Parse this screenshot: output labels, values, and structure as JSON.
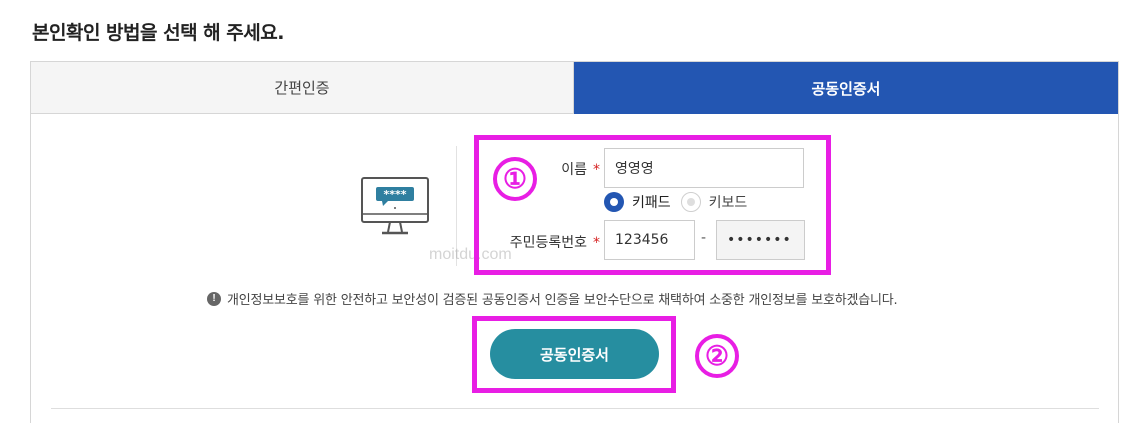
{
  "page": {
    "title": "본인확인 방법을 선택 해 주세요."
  },
  "tabs": [
    {
      "label": "간편인증",
      "active": false
    },
    {
      "label": "공동인증서",
      "active": true
    }
  ],
  "form": {
    "name_label": "이름",
    "name_value": "영영영",
    "required_mark": "*",
    "keyboard_options": [
      {
        "label": "키패드",
        "selected": true
      },
      {
        "label": "키보드",
        "selected": false
      }
    ],
    "id_label": "주민등록번호",
    "id_front_value": "123456",
    "id_separator": "-",
    "id_back_value": "•••••••",
    "monitor_stars": "****"
  },
  "notice": {
    "icon": "!",
    "text": "개인정보보호를 위한 안전하고 보안성이 검증된 공동인증서 인증을 보안수단으로 채택하여 소중한 개인정보를 보호하겠습니다."
  },
  "button": {
    "label": "공동인증서"
  },
  "annotations": {
    "step1": "①",
    "step2": "②"
  },
  "watermark": "moitdu.com",
  "colors": {
    "active_tab": "#2356b2",
    "button": "#268ea0",
    "highlight": "#e81ee4",
    "required": "#d62222"
  }
}
